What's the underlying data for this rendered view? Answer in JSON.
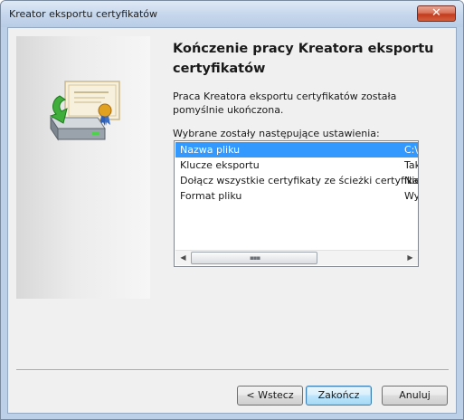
{
  "window": {
    "title": "Kreator eksportu certyfikatów",
    "close_glyph": "✕"
  },
  "wizard": {
    "heading": "Kończenie pracy Kreatora eksportu certyfikatów",
    "description": "Praca Kreatora eksportu certyfikatów została pomyślnie ukończona.",
    "settings_label": "Wybrane zostały następujące ustawienia:",
    "icon": "certificate-export-icon"
  },
  "settings": [
    {
      "name": "Nazwa pliku",
      "value": "C:\\",
      "selected": true
    },
    {
      "name": "Klucze eksportu",
      "value": "Tak",
      "selected": false
    },
    {
      "name": "Dołącz wszystkie certyfikaty ze ścieżki certyfikacji",
      "value": "Nie",
      "selected": false
    },
    {
      "name": "Format pliku",
      "value": "Wy",
      "selected": false
    }
  ],
  "scrollbar": {
    "left_arrow": "◀",
    "right_arrow": "▶"
  },
  "buttons": {
    "back": "< Wstecz",
    "finish": "Zakończ",
    "cancel": "Anuluj"
  },
  "colors": {
    "selection": "#3399ff",
    "close_button": "#c43a1d",
    "default_button": "#3c7fb1"
  }
}
